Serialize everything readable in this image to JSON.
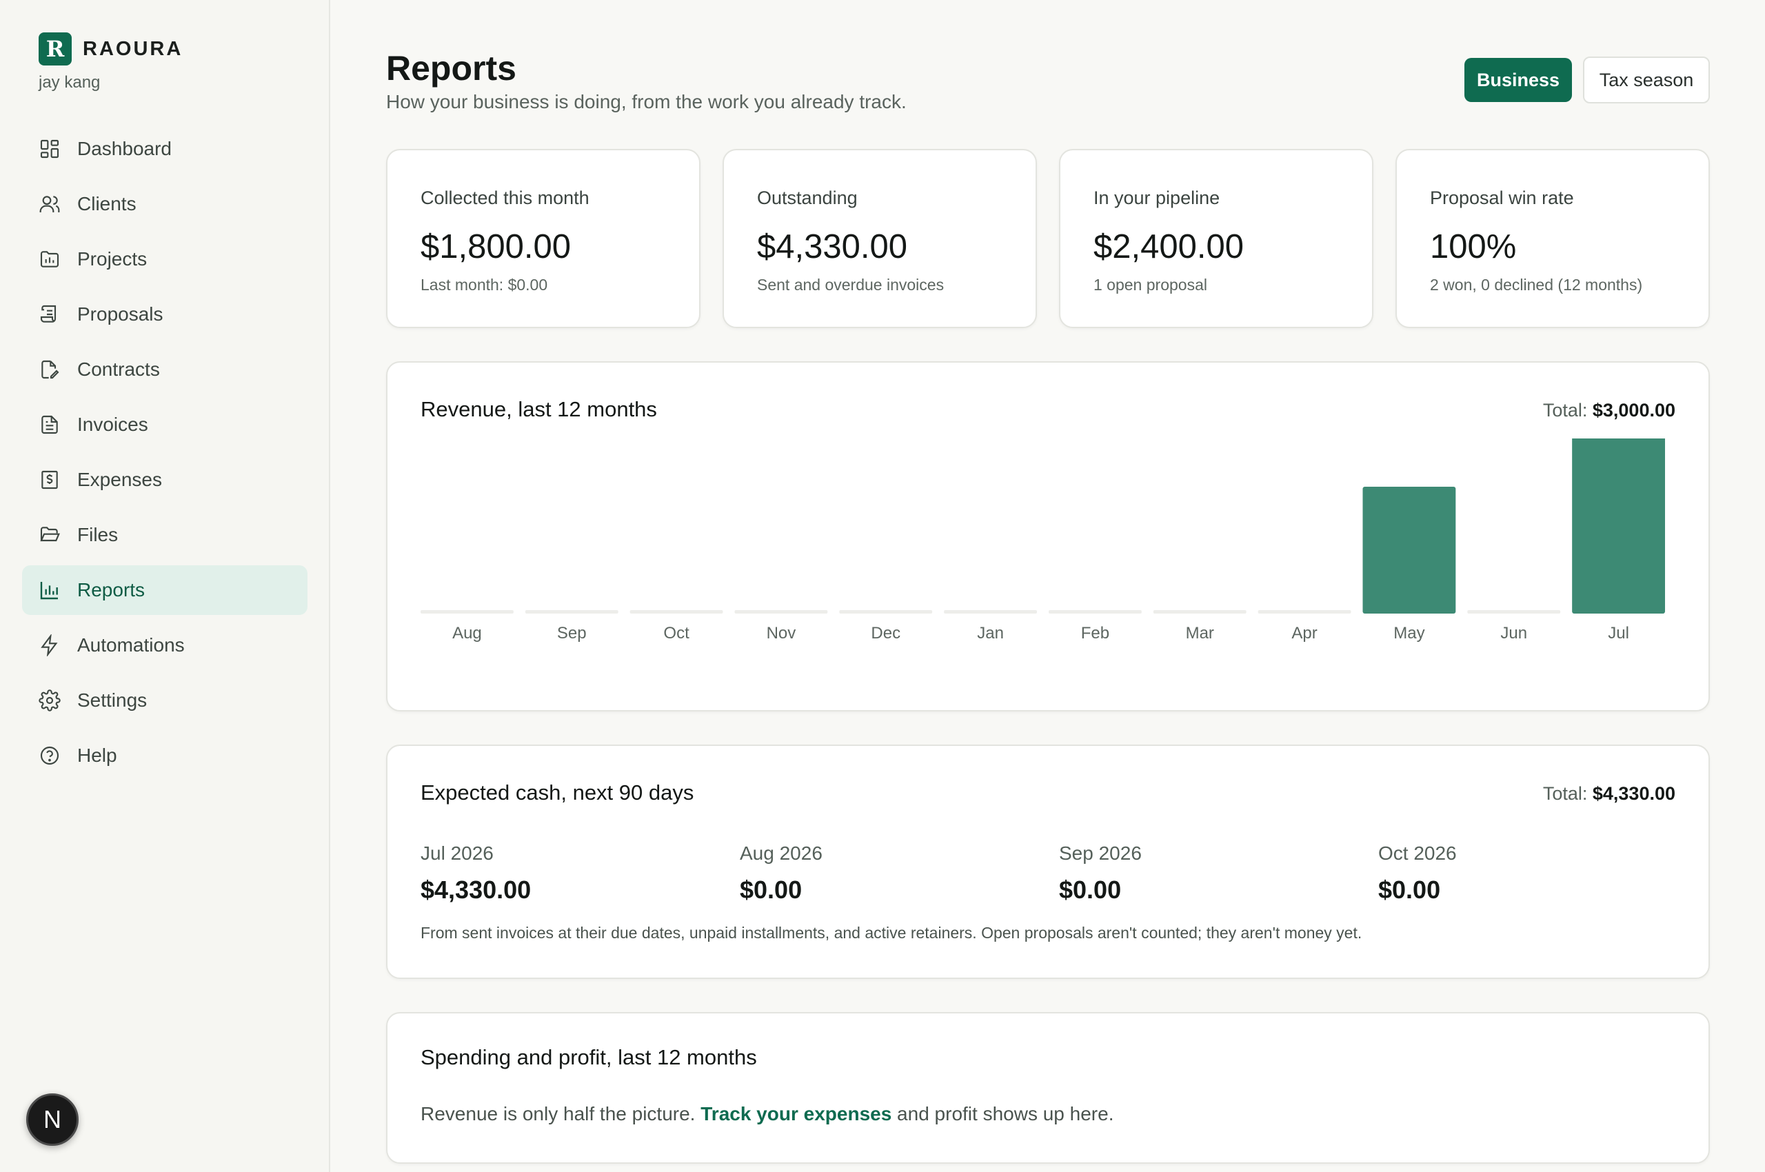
{
  "brand": {
    "mark": "R",
    "name": "RAOURA",
    "user": "jay kang",
    "accent": "#0f6b50"
  },
  "nav": [
    {
      "label": "Dashboard",
      "icon": "dashboard-icon"
    },
    {
      "label": "Clients",
      "icon": "users-icon"
    },
    {
      "label": "Projects",
      "icon": "folder-chart-icon"
    },
    {
      "label": "Proposals",
      "icon": "scroll-icon"
    },
    {
      "label": "Contracts",
      "icon": "file-pen-icon"
    },
    {
      "label": "Invoices",
      "icon": "file-text-icon"
    },
    {
      "label": "Expenses",
      "icon": "receipt-dollar-icon"
    },
    {
      "label": "Files",
      "icon": "folder-open-icon"
    },
    {
      "label": "Reports",
      "icon": "bar-chart-icon",
      "active": true
    },
    {
      "label": "Automations",
      "icon": "bolt-icon"
    },
    {
      "label": "Settings",
      "icon": "gear-icon"
    },
    {
      "label": "Help",
      "icon": "help-circle-icon"
    }
  ],
  "fab": {
    "label": "N"
  },
  "header": {
    "title": "Reports",
    "subtitle": "How your business is doing, from the work you already track.",
    "btn_business": "Business",
    "btn_tax": "Tax season"
  },
  "stats": [
    {
      "label": "Collected this month",
      "value": "$1,800.00",
      "note": "Last month: $0.00"
    },
    {
      "label": "Outstanding",
      "value": "$4,330.00",
      "note": "Sent and overdue invoices"
    },
    {
      "label": "In your pipeline",
      "value": "$2,400.00",
      "note": "1 open proposal"
    },
    {
      "label": "Proposal win rate",
      "value": "100%",
      "note": "2 won, 0 declined (12 months)"
    }
  ],
  "revenue": {
    "title": "Revenue, last 12 months",
    "total_label": "Total:",
    "total_value": "$3,000.00"
  },
  "chart_data": {
    "type": "bar",
    "title": "Revenue, last 12 months",
    "categories": [
      "Aug",
      "Sep",
      "Oct",
      "Nov",
      "Dec",
      "Jan",
      "Feb",
      "Mar",
      "Apr",
      "May",
      "Jun",
      "Jul"
    ],
    "values": [
      0,
      0,
      0,
      0,
      0,
      0,
      0,
      0,
      0,
      1200,
      0,
      1800
    ],
    "ylim": [
      0,
      1800
    ],
    "grid": false,
    "bar_color": "#3d8a74",
    "empty_color": "#ededea"
  },
  "cash": {
    "title": "Expected cash, next 90 days",
    "total_label": "Total:",
    "total_value": "$4,330.00",
    "months": [
      {
        "month": "Jul 2026",
        "amount": "$4,330.00"
      },
      {
        "month": "Aug 2026",
        "amount": "$0.00"
      },
      {
        "month": "Sep 2026",
        "amount": "$0.00"
      },
      {
        "month": "Oct 2026",
        "amount": "$0.00"
      }
    ],
    "note": "From sent invoices at their due dates, unpaid installments, and active retainers. Open proposals aren't counted; they aren't money yet."
  },
  "spending": {
    "title": "Spending and profit, last 12 months",
    "text_before": "Revenue is only half the picture. ",
    "link": "Track your expenses",
    "text_after": " and profit shows up here."
  }
}
